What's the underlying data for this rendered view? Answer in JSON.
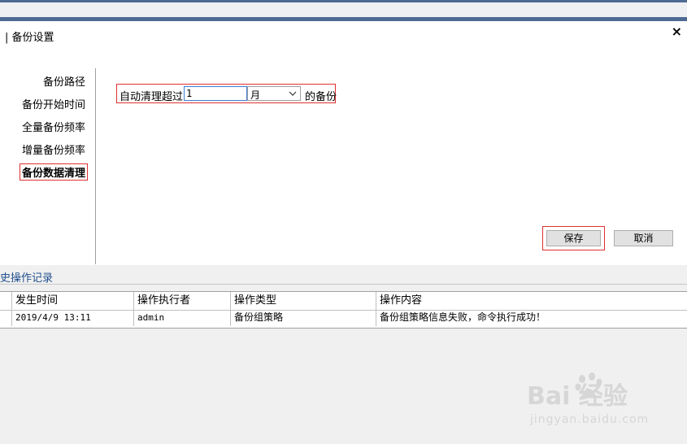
{
  "dialog": {
    "title": "| 备份设置",
    "close": "×"
  },
  "nav": {
    "items": [
      {
        "label": "备份路径"
      },
      {
        "label": "备份开始时间"
      },
      {
        "label": "全量备份频率"
      },
      {
        "label": "增量备份频率"
      },
      {
        "label": "备份数据清理",
        "active": true
      }
    ]
  },
  "cleanup": {
    "prefix": "自动清理超过",
    "value": "1",
    "unit": "月",
    "suffix": "的备份"
  },
  "buttons": {
    "save": "保存",
    "cancel": "取消"
  },
  "history": {
    "title": "史操作记录",
    "columns": [
      "发生时间",
      "操作执行者",
      "操作类型",
      "操作内容"
    ],
    "rows": [
      [
        "2019/4/9 13:11",
        "admin",
        "备份组策略",
        "备份组策略信息失败，命令执行成功！"
      ]
    ]
  },
  "watermark": {
    "logo": "Bai  经验",
    "sub": "jingyan.baidu.com"
  },
  "colors": {
    "accent_bar": "#4d6a93",
    "highlight_border": "#e03030",
    "history_title": "#1f4e8c"
  }
}
